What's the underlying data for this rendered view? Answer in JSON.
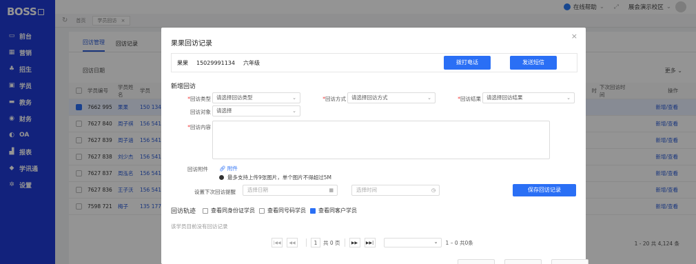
{
  "sidebar": {
    "logo": "BOSS",
    "items": [
      {
        "label": "前台",
        "icon": "monitor-icon"
      },
      {
        "label": "营销",
        "icon": "gift-icon"
      },
      {
        "label": "招生",
        "icon": "users-icon"
      },
      {
        "label": "学员",
        "icon": "id-card-icon"
      },
      {
        "label": "教务",
        "icon": "board-icon"
      },
      {
        "label": "财务",
        "icon": "finance-icon"
      },
      {
        "label": "OA",
        "icon": "toggle-icon"
      },
      {
        "label": "报表",
        "icon": "chart-icon"
      },
      {
        "label": "学讯通",
        "icon": "message-icon"
      },
      {
        "label": "设置",
        "icon": "gear-icon"
      }
    ]
  },
  "topbar": {
    "help": "在线帮助",
    "school": "展会演示校区"
  },
  "tabsbar": {
    "home": "首页",
    "current": "学员回访",
    "close": "×"
  },
  "main": {
    "tabs": [
      "回访管理",
      "回访记录"
    ],
    "filter_label": "回访日期",
    "more": "更多",
    "columns": {
      "id": "学员编号",
      "name": "学员姓名",
      "phone": "学员",
      "last_time": "时",
      "next": "下次回访时间",
      "op": "操作"
    },
    "rows": [
      {
        "id": "7662 995",
        "name": "果果",
        "phone": "150 134",
        "op": "新增/查看",
        "checked": true
      },
      {
        "id": "7627 840",
        "name": "周子祺",
        "phone": "156 541",
        "op": "新增/查看",
        "checked": false
      },
      {
        "id": "7627 839",
        "name": "周子涵",
        "phone": "156 541",
        "op": "新增/查看",
        "checked": false
      },
      {
        "id": "7627 838",
        "name": "刘少杰",
        "phone": "156 541",
        "op": "新增/查看",
        "checked": false
      },
      {
        "id": "7627 837",
        "name": "周泓名",
        "phone": "156 541",
        "op": "新增/查看",
        "checked": false
      },
      {
        "id": "7627 836",
        "name": "王子沃",
        "phone": "156 541",
        "op": "新增/查看",
        "checked": false
      },
      {
        "id": "7598 721",
        "name": "梅子",
        "phone": "135 177",
        "op": "新增/查看",
        "checked": false
      }
    ],
    "pager_summary": "1 - 20  共 4,124 条"
  },
  "modal": {
    "title": "果果回访记录",
    "close": "×",
    "student_name": "果果",
    "student_phone": "15029991134",
    "student_grade": "六年级",
    "call_button": "拨打电话",
    "sms_button": "发送短信",
    "new_section": "新增回访",
    "type_label": "回访类型",
    "type_placeholder": "请选择回访类型",
    "method_label": "回访方式",
    "method_placeholder": "请选择回访方式",
    "result_label": "回访结果",
    "result_placeholder": "请选择回访结果",
    "target_label": "回访对象",
    "target_placeholder": "请选择",
    "content_label": "回访内容",
    "attach_label": "回访附件",
    "attach_link": "附件",
    "attach_hint": "最多支持上传9张图片，单个图片不得超过5M",
    "reminder_label": "设置下次回访提醒",
    "date_placeholder": "选择日期",
    "time_placeholder": "选择时间",
    "save_button": "保存回访记录",
    "track_title": "回访轨迹",
    "track_opts": [
      {
        "label": "查看同身份证学员",
        "checked": false
      },
      {
        "label": "查看同号码学员",
        "checked": false
      },
      {
        "label": "查看同客户学员",
        "checked": true
      }
    ],
    "empty_text": "该学员目前没有回访记录",
    "pager_page": "1",
    "pager_total_pages": "共 0 页",
    "pager_range": "1 – 0  共0条"
  }
}
